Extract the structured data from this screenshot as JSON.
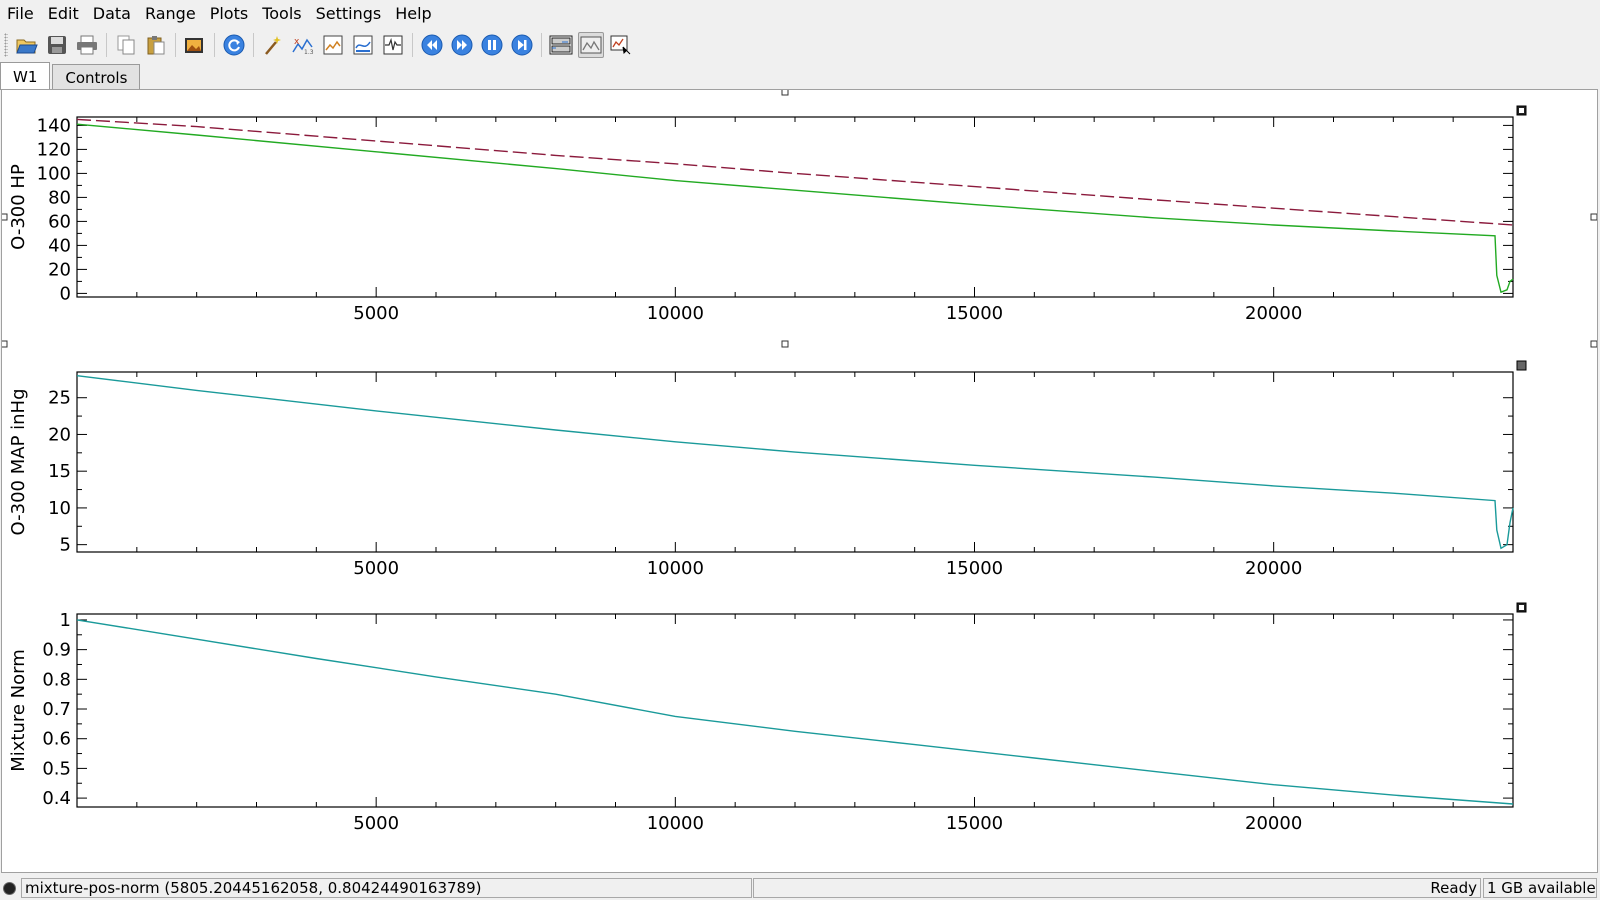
{
  "menubar": {
    "items": [
      "File",
      "Edit",
      "Data",
      "Range",
      "Plots",
      "Tools",
      "Settings",
      "Help"
    ]
  },
  "toolbar": {
    "buttons": [
      {
        "icon": "open-folder-icon",
        "color": "#3a78c8"
      },
      {
        "icon": "save-icon",
        "color": "#555555"
      },
      {
        "icon": "print-icon",
        "color": "#555555"
      },
      {
        "icon": "copy-icon",
        "color": "#888888"
      },
      {
        "icon": "paste-icon",
        "color": "#c8a040"
      },
      {
        "icon": "export-image-icon",
        "color": "#d08020"
      },
      {
        "icon": "reload-icon",
        "color": "#2a6fd0"
      },
      {
        "icon": "wizard-wand-icon",
        "color": "#d0a020"
      },
      {
        "icon": "data-manager-icon",
        "color": "#c04020"
      },
      {
        "icon": "edit-plot-icon",
        "color": "#d08020"
      },
      {
        "icon": "edit-vector-icon",
        "color": "#2a6fd0"
      },
      {
        "icon": "filter-icon",
        "color": "#333333"
      },
      {
        "icon": "back-icon",
        "color": "#2a6fd0"
      },
      {
        "icon": "forward-icon",
        "color": "#2a6fd0"
      },
      {
        "icon": "pause-icon",
        "color": "#2a6fd0"
      },
      {
        "icon": "end-icon",
        "color": "#2a6fd0"
      },
      {
        "icon": "layout-mode-icon",
        "color": "#333333"
      },
      {
        "icon": "zoom-mode-icon",
        "color": "#555555",
        "active": true
      },
      {
        "icon": "data-mode-icon",
        "color": "#333333"
      }
    ]
  },
  "tabs": [
    {
      "label": "W1",
      "selected": true
    },
    {
      "label": "Controls",
      "selected": false
    }
  ],
  "chart_data": [
    {
      "type": "line",
      "ylabel": "O-300 HP",
      "xlabel": "",
      "xlim": [
        0,
        24000
      ],
      "ylim": [
        -3,
        147
      ],
      "xticks": [
        5000,
        10000,
        15000,
        20000
      ],
      "yticks": [
        0,
        20,
        40,
        60,
        80,
        100,
        120,
        140
      ],
      "series": [
        {
          "color": "#8b1a3c",
          "dash": true,
          "x": [
            0,
            2000,
            5000,
            8000,
            10000,
            12000,
            15000,
            18000,
            20000,
            22000,
            24000
          ],
          "y": [
            145,
            139,
            127,
            115,
            108,
            100,
            89,
            78,
            71,
            64,
            57
          ]
        },
        {
          "color": "#22aa22",
          "dash": false,
          "x": [
            0,
            2000,
            5000,
            8000,
            10000,
            12000,
            15000,
            18000,
            20000,
            22000,
            23700,
            23730,
            23800,
            23900,
            23950,
            24000
          ],
          "y": [
            141,
            132,
            118,
            104,
            94,
            86,
            74,
            63,
            57,
            52,
            48,
            15,
            1,
            3,
            10,
            12
          ]
        }
      ]
    },
    {
      "type": "line",
      "ylabel": "O-300 MAP inHg",
      "xlabel": "",
      "xlim": [
        0,
        24000
      ],
      "ylim": [
        4,
        28.5
      ],
      "xticks": [
        5000,
        10000,
        15000,
        20000
      ],
      "yticks": [
        5,
        10,
        15,
        20,
        25
      ],
      "series": [
        {
          "color": "#1a9a9a",
          "dash": false,
          "x": [
            0,
            2000,
            5000,
            8000,
            10000,
            12000,
            15000,
            18000,
            20000,
            22000,
            23700,
            23730,
            23800,
            23900,
            23950,
            24000
          ],
          "y": [
            28,
            26.0,
            23.2,
            20.6,
            19.0,
            17.6,
            15.8,
            14.2,
            13.0,
            12.0,
            11.0,
            7,
            4.5,
            5.0,
            8,
            10
          ]
        }
      ]
    },
    {
      "type": "line",
      "ylabel": "Mixture Norm",
      "xlabel": "",
      "xlim": [
        0,
        24000
      ],
      "ylim": [
        0.37,
        1.02
      ],
      "xticks": [
        5000,
        10000,
        15000,
        20000
      ],
      "yticks": [
        0.4,
        0.5,
        0.6,
        0.7,
        0.8,
        0.9,
        1
      ],
      "series": [
        {
          "color": "#1a9a9a",
          "dash": false,
          "x": [
            0,
            2000,
            4000,
            6000,
            8000,
            10000,
            12000,
            14000,
            16000,
            18000,
            20000,
            22000,
            24000
          ],
          "y": [
            1.0,
            0.935,
            0.87,
            0.808,
            0.75,
            0.675,
            0.625,
            0.58,
            0.535,
            0.49,
            0.445,
            0.41,
            0.38
          ]
        }
      ]
    }
  ],
  "statusbar": {
    "message": "mixture-pos-norm (5805.20445162058, 0.80424490163789)",
    "state": "Ready",
    "memory": "1 GB available"
  }
}
